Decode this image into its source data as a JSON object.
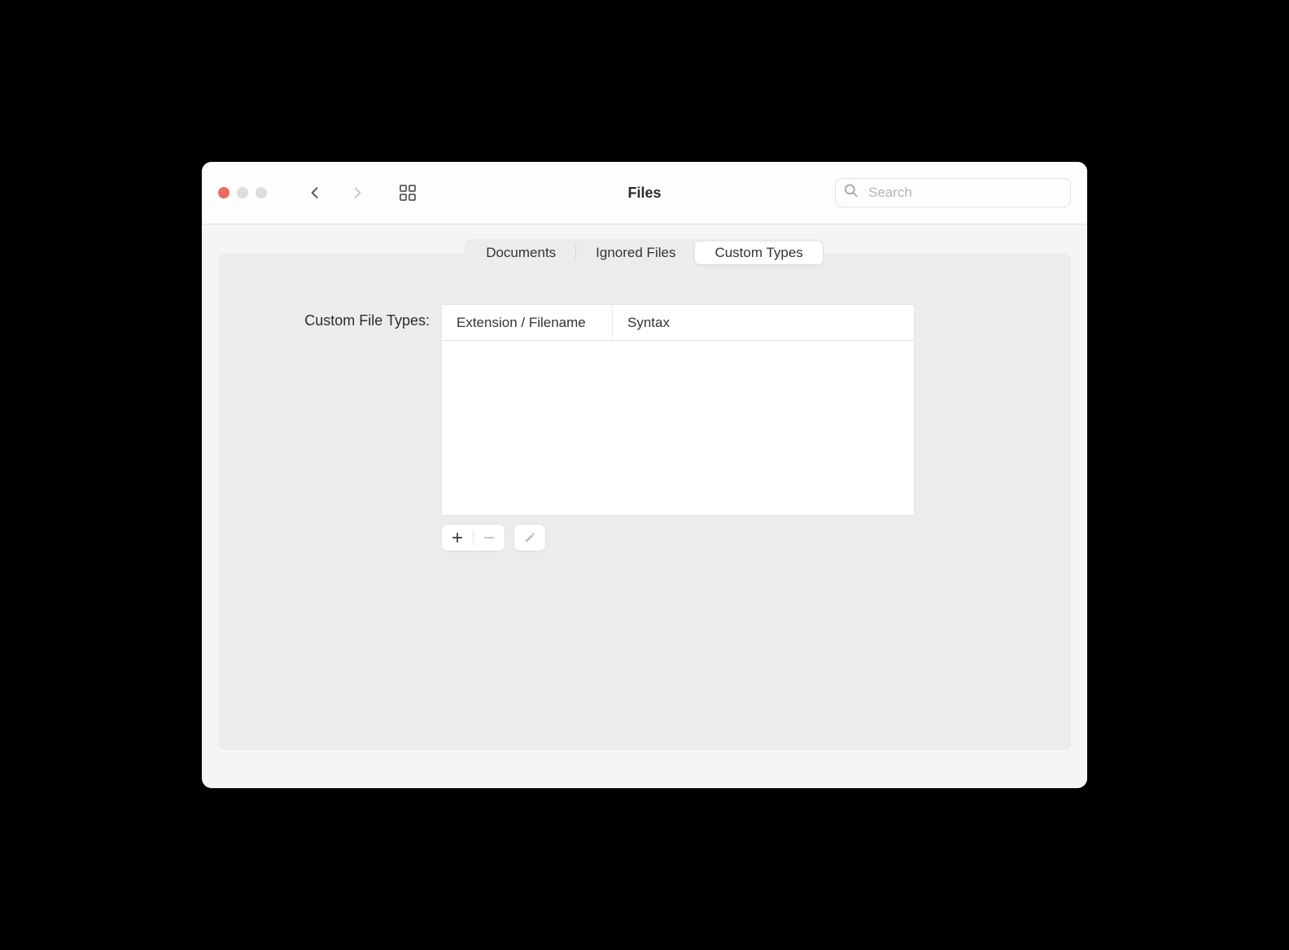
{
  "window": {
    "title": "Files"
  },
  "search": {
    "placeholder": "Search",
    "value": ""
  },
  "tabs": [
    {
      "label": "Documents",
      "active": false
    },
    {
      "label": "Ignored Files",
      "active": false
    },
    {
      "label": "Custom Types",
      "active": true
    }
  ],
  "customTypes": {
    "label": "Custom File Types:",
    "columns": [
      "Extension / Filename",
      "Syntax"
    ],
    "rows": []
  }
}
